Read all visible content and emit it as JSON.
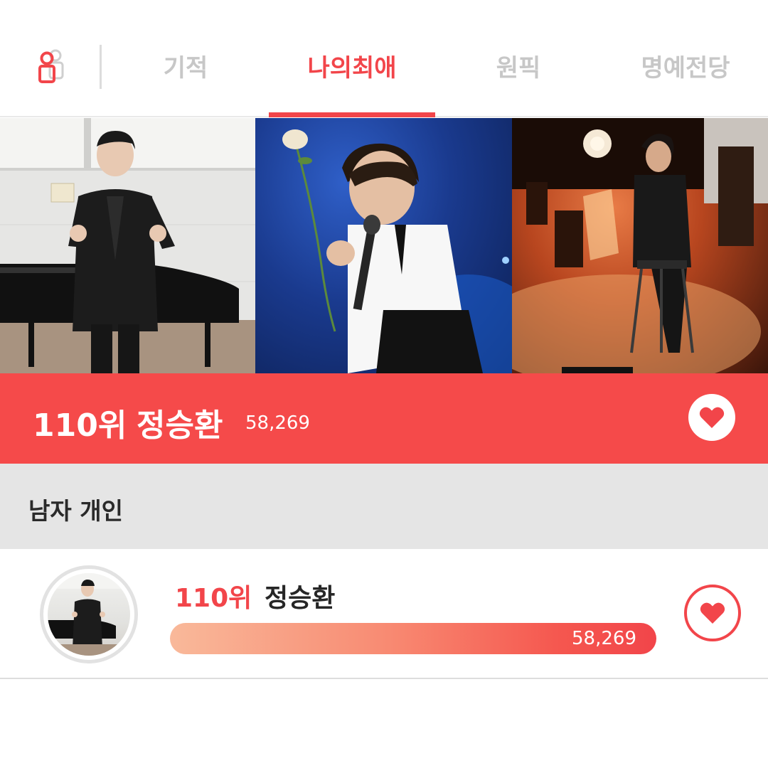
{
  "nav": {
    "profile_icon": "user-profile-icon",
    "tabs": [
      {
        "label": "기적",
        "active": false
      },
      {
        "label": "나의최애",
        "active": true
      },
      {
        "label": "원픽",
        "active": false
      },
      {
        "label": "명예전당",
        "active": false
      }
    ]
  },
  "banner": {
    "rank": "110위",
    "name": "정승환",
    "votes": "58,269",
    "heart_icon": "heart-icon"
  },
  "category": {
    "title": "남자 개인"
  },
  "ranking": [
    {
      "rank": "110위",
      "name": "정승환",
      "votes": "58,269",
      "progress": 1.0
    }
  ],
  "colors": {
    "accent": "#f2454a",
    "banner": "#f54a4a",
    "inactive_tab": "#c7c7c7",
    "category_bg": "#e5e5e5"
  }
}
